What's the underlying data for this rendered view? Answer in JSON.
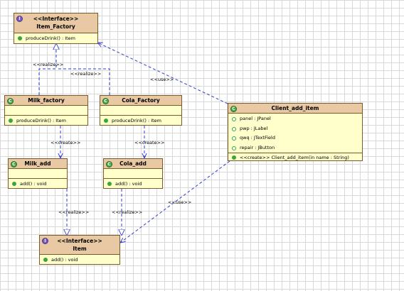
{
  "classes": {
    "item_factory": {
      "stereotype": "<<Interface>>",
      "name": "Item_Factory",
      "methods": [
        "produceDrink() : Item"
      ]
    },
    "milk_factory": {
      "name": "Milk_factory",
      "methods": [
        "produceDrink() : Item"
      ]
    },
    "cola_factory": {
      "name": "Cola_Factory",
      "methods": [
        "produceDrink() : Item"
      ]
    },
    "client_add_item": {
      "name": "Client_add_item",
      "fields": [
        "panel : JPanel",
        "pwp : JLabel",
        "qwq : JTextField",
        "repair : JButton"
      ],
      "methods": [
        "<<create>> Client_add_item(in name : String)"
      ]
    },
    "milk_add": {
      "name": "Milk_add",
      "methods": [
        "add() : void"
      ]
    },
    "cola_add": {
      "name": "Cola_add",
      "methods": [
        "add() : void"
      ]
    },
    "item": {
      "stereotype": "<<Interface>>",
      "name": "Item",
      "methods": [
        "add() : void"
      ]
    }
  },
  "relations": {
    "realize_top_left": "<<realize>>",
    "realize_top_right": "<<realize>>",
    "use_top": "<<use>>",
    "create_left": "<<create>>",
    "create_right": "<<create>>",
    "realize_bottom_left": "<<realize>>",
    "realize_bottom_right": "<<realize>>",
    "use_bottom": "<<use>>"
  },
  "colors": {
    "header": "#e9c9a3",
    "body": "#ffffcc",
    "border": "#7a5a2a",
    "arrow": "#2f3fd0",
    "class_icon": "#4aa84a",
    "interface_icon": "#7a5cc0"
  },
  "icons": {
    "class": "class-icon",
    "interface": "interface-icon",
    "method": "public-method-icon",
    "field": "field-icon"
  }
}
